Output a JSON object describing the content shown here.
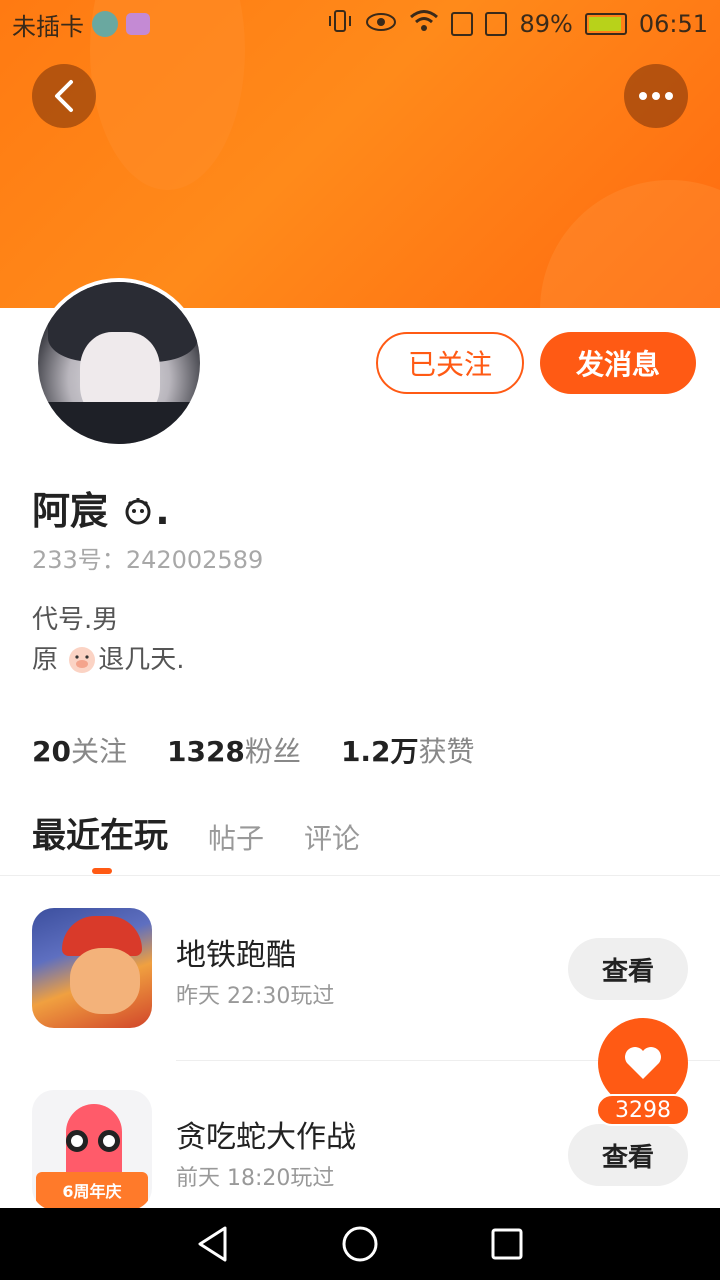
{
  "status_bar": {
    "carrier": "未插卡",
    "battery": "89%",
    "time": "06:51"
  },
  "header": {
    "back_icon": "chevron-left-icon",
    "more_icon": "more-dots-icon"
  },
  "profile": {
    "follow_state_label": "已关注",
    "message_label": "发消息",
    "username": "阿宸",
    "id_label": "233号：",
    "id_value": "242002589",
    "bio_line1": "代号.男",
    "bio_line2_pre": "原",
    "bio_line2_post": "退几天."
  },
  "stats": [
    {
      "num": "20",
      "label": "关注"
    },
    {
      "num": "1328",
      "label": "粉丝"
    },
    {
      "num": "1.2万",
      "label": "获赞"
    }
  ],
  "tabs": [
    {
      "label": "最近在玩",
      "active": true
    },
    {
      "label": "帖子",
      "active": false
    },
    {
      "label": "评论",
      "active": false
    }
  ],
  "games": [
    {
      "name": "地铁跑酷",
      "time": "昨天 22:30玩过",
      "action": "查看"
    },
    {
      "name": "贪吃蛇大作战",
      "time": "前天 18:20玩过",
      "action": "查看",
      "icon_text": "6周年庆"
    }
  ],
  "like": {
    "count": "3298",
    "color": "#ff5a14"
  },
  "colors": {
    "accent": "#ff5a14",
    "header": "#ff7a12"
  }
}
